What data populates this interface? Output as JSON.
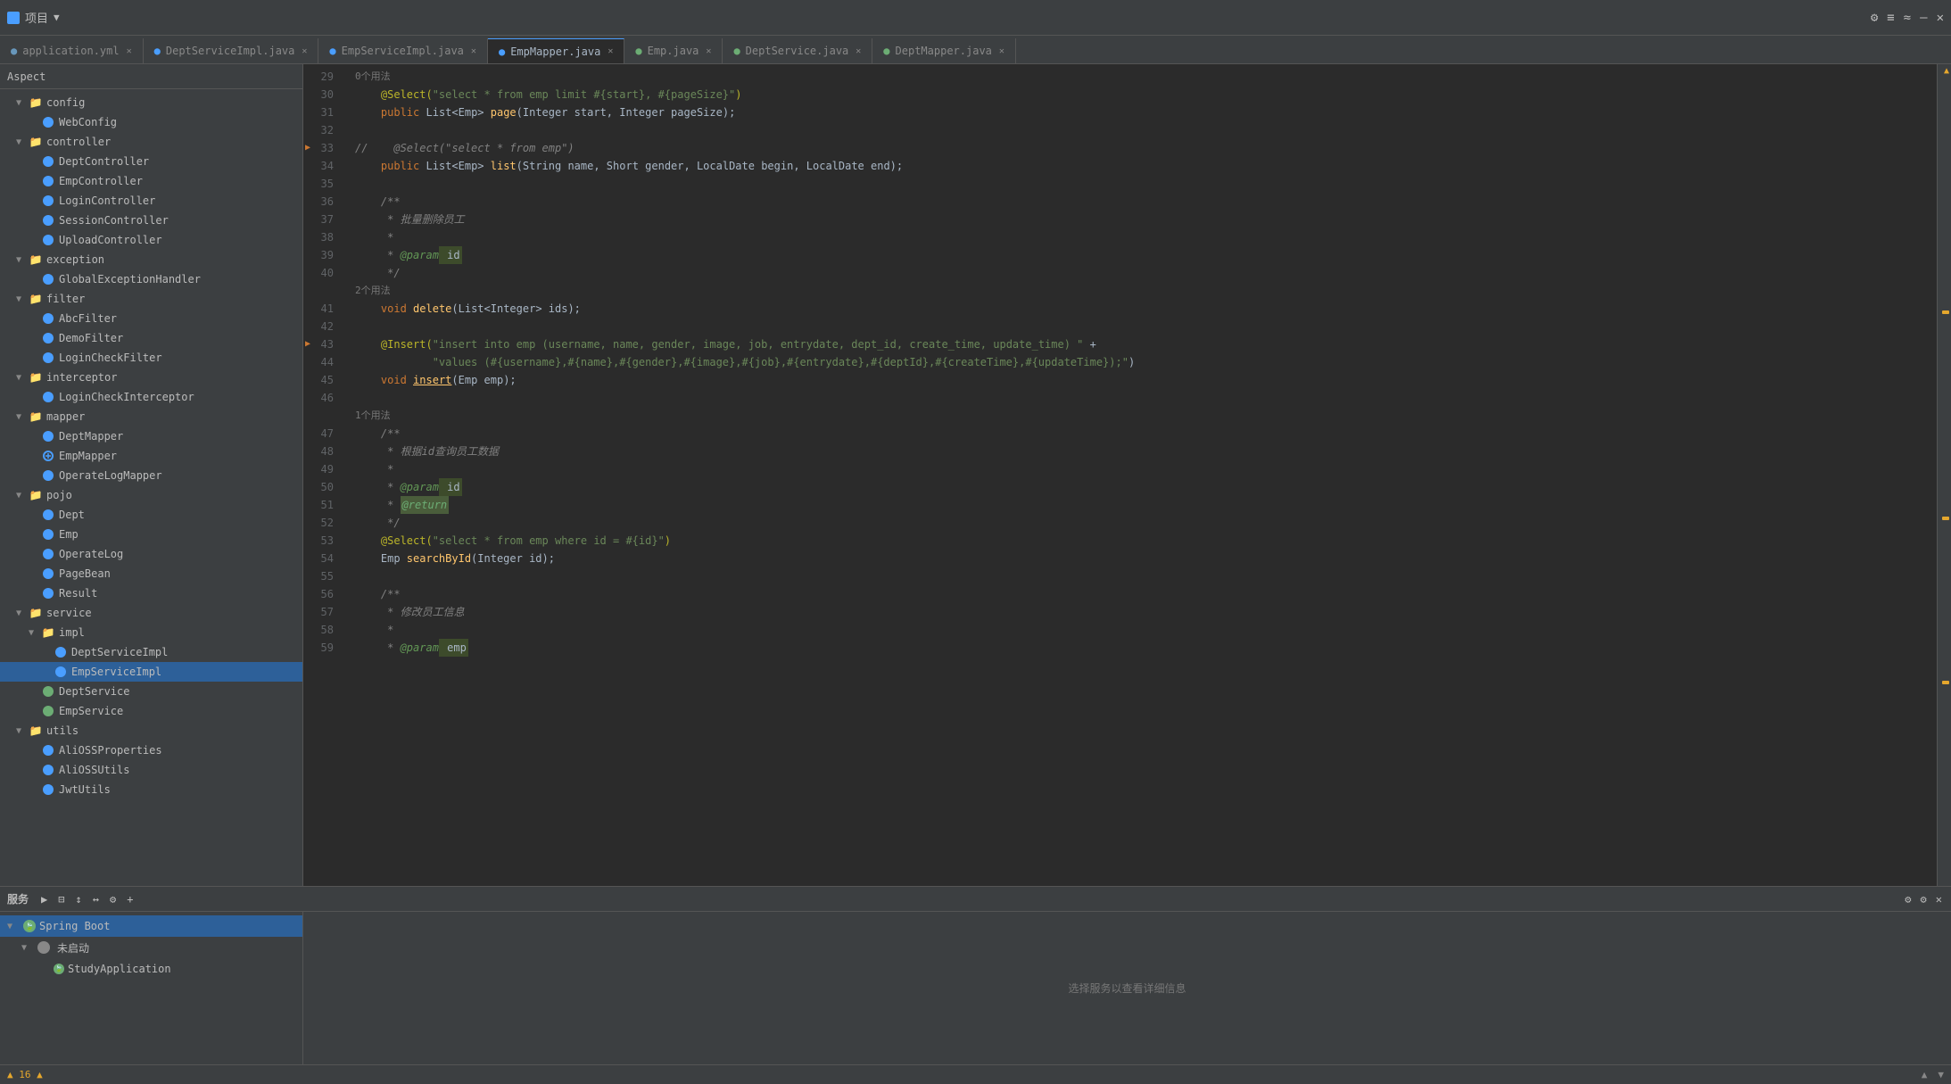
{
  "topbar": {
    "title": "项目",
    "dropdown": "▼",
    "icons": [
      "⚙",
      "≡",
      "≈",
      "—",
      "✕"
    ]
  },
  "tabs": [
    {
      "id": "application-yml",
      "label": "application.yml",
      "type": "yml",
      "active": false
    },
    {
      "id": "DeptServiceImpl",
      "label": "DeptServiceImpl.java",
      "type": "java-d",
      "active": false
    },
    {
      "id": "EmpServiceImpl",
      "label": "EmpServiceImpl.java",
      "type": "java-d",
      "active": false
    },
    {
      "id": "EmpMapper",
      "label": "EmpMapper.java",
      "type": "java-d",
      "active": true
    },
    {
      "id": "Emp",
      "label": "Emp.java",
      "type": "java-i",
      "active": false
    },
    {
      "id": "DeptService",
      "label": "DeptService.java",
      "type": "java-i",
      "active": false
    },
    {
      "id": "DeptMapper",
      "label": "DeptMapper.java",
      "type": "java-i",
      "active": false
    }
  ],
  "sidebar": {
    "header": "Aspect",
    "tree": [
      {
        "id": "config",
        "label": "config",
        "type": "folder",
        "indent": 1,
        "open": true
      },
      {
        "id": "WebConfig",
        "label": "WebConfig",
        "type": "java-blue",
        "indent": 2
      },
      {
        "id": "controller",
        "label": "controller",
        "type": "folder",
        "indent": 1,
        "open": true
      },
      {
        "id": "DeptController",
        "label": "DeptController",
        "type": "java-blue",
        "indent": 2
      },
      {
        "id": "EmpController",
        "label": "EmpController",
        "type": "java-blue",
        "indent": 2
      },
      {
        "id": "LoginController",
        "label": "LoginController",
        "type": "java-blue",
        "indent": 2
      },
      {
        "id": "SessionController",
        "label": "SessionController",
        "type": "java-blue",
        "indent": 2
      },
      {
        "id": "UploadController",
        "label": "UploadController",
        "type": "java-blue",
        "indent": 2
      },
      {
        "id": "exception",
        "label": "exception",
        "type": "folder",
        "indent": 1,
        "open": true
      },
      {
        "id": "GlobalExceptionHandler",
        "label": "GlobalExceptionHandler",
        "type": "java-blue",
        "indent": 2
      },
      {
        "id": "filter",
        "label": "filter",
        "type": "folder",
        "indent": 1,
        "open": true
      },
      {
        "id": "AbcFilter",
        "label": "AbcFilter",
        "type": "java-blue",
        "indent": 2
      },
      {
        "id": "DemoFilter",
        "label": "DemoFilter",
        "type": "java-blue",
        "indent": 2
      },
      {
        "id": "LoginCheckFilter",
        "label": "LoginCheckFilter",
        "type": "java-blue",
        "indent": 2
      },
      {
        "id": "interceptor",
        "label": "interceptor",
        "type": "folder",
        "indent": 1,
        "open": true
      },
      {
        "id": "LoginCheckInterceptor",
        "label": "LoginCheckInterceptor",
        "type": "java-blue",
        "indent": 2
      },
      {
        "id": "mapper",
        "label": "mapper",
        "type": "folder",
        "indent": 1,
        "open": true
      },
      {
        "id": "DeptMapper",
        "label": "DeptMapper",
        "type": "java-blue",
        "indent": 2
      },
      {
        "id": "EmpMapper",
        "label": "EmpMapper",
        "type": "java-blue",
        "indent": 2
      },
      {
        "id": "OperateLogMapper",
        "label": "OperateLogMapper",
        "type": "java-blue",
        "indent": 2
      },
      {
        "id": "pojo",
        "label": "pojo",
        "type": "folder",
        "indent": 1,
        "open": true
      },
      {
        "id": "Dept",
        "label": "Dept",
        "type": "java-blue",
        "indent": 2
      },
      {
        "id": "Emp",
        "label": "Emp",
        "type": "java-blue",
        "indent": 2
      },
      {
        "id": "OperateLog",
        "label": "OperateLog",
        "type": "java-blue",
        "indent": 2
      },
      {
        "id": "PageBean",
        "label": "PageBean",
        "type": "java-blue",
        "indent": 2
      },
      {
        "id": "Result",
        "label": "Result",
        "type": "java-blue",
        "indent": 2
      },
      {
        "id": "service",
        "label": "service",
        "type": "folder",
        "indent": 1,
        "open": true
      },
      {
        "id": "impl",
        "label": "impl",
        "type": "folder",
        "indent": 2,
        "open": true
      },
      {
        "id": "DeptServiceImpl",
        "label": "DeptServiceImpl",
        "type": "java-blue",
        "indent": 3
      },
      {
        "id": "EmpServiceImpl",
        "label": "EmpServiceImpl",
        "type": "java-blue",
        "indent": 3,
        "selected": true
      },
      {
        "id": "DeptService",
        "label": "DeptService",
        "type": "java-green",
        "indent": 2
      },
      {
        "id": "EmpService",
        "label": "EmpService",
        "type": "java-green",
        "indent": 2
      },
      {
        "id": "utils",
        "label": "utils",
        "type": "folder",
        "indent": 1,
        "open": true
      },
      {
        "id": "AliOSSProperties",
        "label": "AliOSSProperties",
        "type": "java-blue",
        "indent": 2
      },
      {
        "id": "AliOSSUtils",
        "label": "AliOSSUtils",
        "type": "java-blue",
        "indent": 2
      },
      {
        "id": "JwtUtils",
        "label": "JwtUtils",
        "type": "java-blue",
        "indent": 2
      }
    ]
  },
  "editor": {
    "filename": "EmpMapper.java",
    "lines": [
      {
        "num": 29,
        "content": "    0个用法",
        "type": "usage"
      },
      {
        "num": 30,
        "content": "    @Select(\"select * from emp limit #{start}, #{pageSize}\")",
        "type": "code"
      },
      {
        "num": 31,
        "content": "    public List<Emp> page(Integer start, Integer pageSize);",
        "type": "code"
      },
      {
        "num": 32,
        "content": "",
        "type": "code"
      },
      {
        "num": 33,
        "content": "//    @Select(\"select * from emp\")",
        "type": "code",
        "arrow": true
      },
      {
        "num": 34,
        "content": "    public List<Emp> list(String name, Short gender, LocalDate begin, LocalDate end);",
        "type": "code"
      },
      {
        "num": 35,
        "content": "",
        "type": "code"
      },
      {
        "num": 36,
        "content": "    /**",
        "type": "code"
      },
      {
        "num": 37,
        "content": "     * 批量删除员工",
        "type": "code"
      },
      {
        "num": 38,
        "content": "     *",
        "type": "code"
      },
      {
        "num": 39,
        "content": "     * @param id",
        "type": "code"
      },
      {
        "num": 40,
        "content": "     */",
        "type": "code"
      },
      {
        "num": "2个用法",
        "content": "",
        "type": "usage-label"
      },
      {
        "num": 41,
        "content": "    void delete(List<Integer> ids);",
        "type": "code"
      },
      {
        "num": 42,
        "content": "",
        "type": "code"
      },
      {
        "num": 43,
        "content": "    @Insert(\"insert into emp (username, name, gender, image, job, entrydate, dept_id, create_time, update_time) \" +",
        "type": "code",
        "arrow": true
      },
      {
        "num": 44,
        "content": "            \"values (#{username},#{name},#{gender},#{image},#{job},#{entrydate},#{deptId},#{createTime},#{updateTime});\")",
        "type": "code"
      },
      {
        "num": 45,
        "content": "    void insert(Emp emp);",
        "type": "code"
      },
      {
        "num": 46,
        "content": "",
        "type": "code"
      },
      {
        "num": "1个用法",
        "content": "",
        "type": "usage-label"
      },
      {
        "num": 47,
        "content": "    /**",
        "type": "code"
      },
      {
        "num": 48,
        "content": "     * 根据id查询员工数据",
        "type": "code"
      },
      {
        "num": 49,
        "content": "     *",
        "type": "code"
      },
      {
        "num": 50,
        "content": "     * @param id",
        "type": "code"
      },
      {
        "num": 51,
        "content": "     * @return",
        "type": "code"
      },
      {
        "num": 52,
        "content": "     */",
        "type": "code"
      },
      {
        "num": 53,
        "content": "    @Select(\"select * from emp where id = #{id}\")",
        "type": "code"
      },
      {
        "num": 54,
        "content": "    Emp searchById(Integer id);",
        "type": "code"
      },
      {
        "num": 55,
        "content": "",
        "type": "code"
      },
      {
        "num": 56,
        "content": "    /**",
        "type": "code"
      },
      {
        "num": 57,
        "content": "     * 修改员工信息",
        "type": "code"
      },
      {
        "num": 58,
        "content": "     *",
        "type": "code"
      },
      {
        "num": 59,
        "content": "     * @param emp",
        "type": "code"
      }
    ]
  },
  "bottom_panel": {
    "title": "服务",
    "icons": [
      "▶",
      "⊟",
      "↕",
      "↔",
      "⇄",
      "+"
    ],
    "tree": [
      {
        "id": "spring-boot",
        "label": "Spring Boot",
        "type": "spring",
        "indent": 1,
        "open": true,
        "selected": true
      },
      {
        "id": "not-started",
        "label": "未启动",
        "type": "arrow",
        "indent": 2
      },
      {
        "id": "StudyApplication",
        "label": "StudyApplication",
        "type": "spring-small",
        "indent": 3
      }
    ],
    "main_text": "选择服务以查看详细信息",
    "right_icons": [
      "⚙",
      "⚙",
      "✕"
    ]
  },
  "status_bar": {
    "warnings": "▲ 16 ▲",
    "right_items": [
      "▲",
      "▼"
    ]
  }
}
